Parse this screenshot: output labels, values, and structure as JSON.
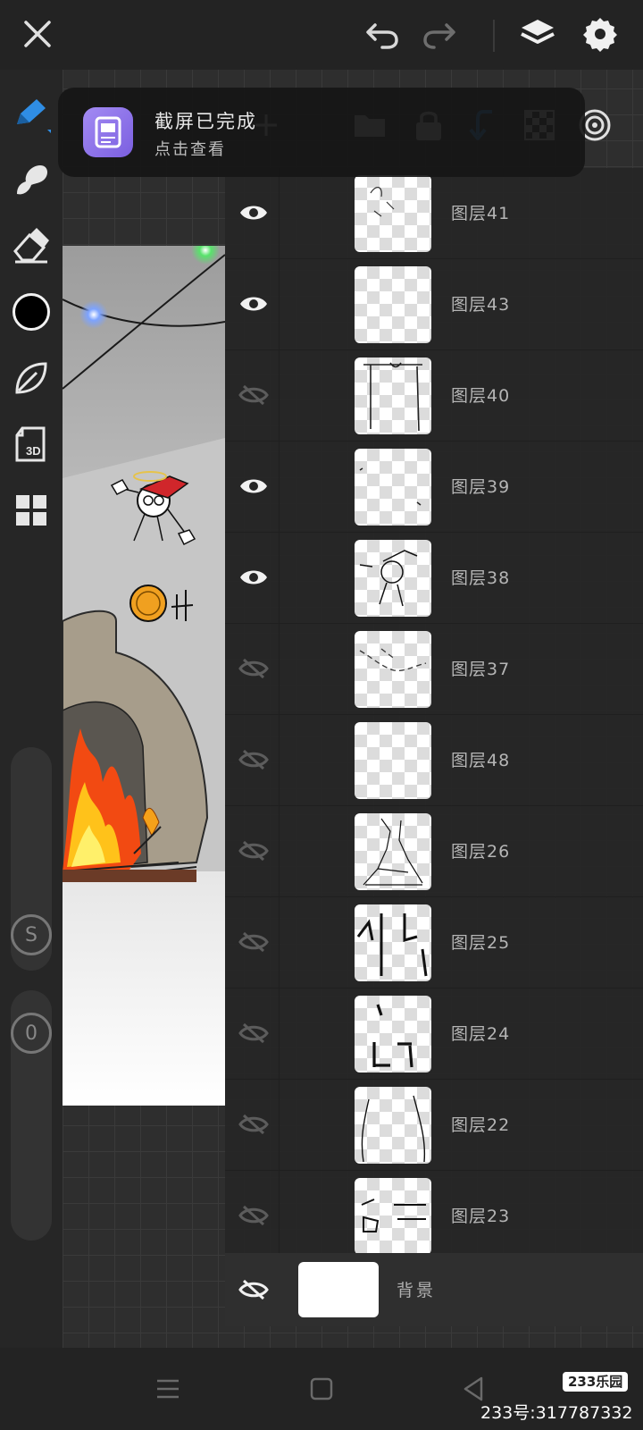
{
  "notification": {
    "title": "截屏已完成",
    "subtitle": "点击查看"
  },
  "layers": [
    {
      "name": "图层41",
      "visible": true
    },
    {
      "name": "图层43",
      "visible": true
    },
    {
      "name": "图层40",
      "visible": false
    },
    {
      "name": "图层39",
      "visible": true
    },
    {
      "name": "图层38",
      "visible": true
    },
    {
      "name": "图层37",
      "visible": false
    },
    {
      "name": "图层48",
      "visible": false
    },
    {
      "name": "图层26",
      "visible": false
    },
    {
      "name": "图层25",
      "visible": false
    },
    {
      "name": "图层24",
      "visible": false
    },
    {
      "name": "图层22",
      "visible": false
    },
    {
      "name": "图层23",
      "visible": false
    }
  ],
  "background_layer": {
    "name": "背景",
    "visible": false
  },
  "left_toolbar": {
    "brush_icon": "pencil-icon",
    "smudge_icon": "smudge-icon",
    "eraser_icon": "eraser-icon",
    "color_swatch": "#000000",
    "leaf_icon": "leaf-icon",
    "threed_label": "3D",
    "grid_icon": "apps-icon",
    "size_label": "S",
    "opacity_label": "0"
  },
  "watermark": {
    "badge": "233乐园",
    "id_text": "233号:317787332"
  },
  "colors": {
    "accent": "#2f8de4",
    "background": "#2a2a2a"
  }
}
